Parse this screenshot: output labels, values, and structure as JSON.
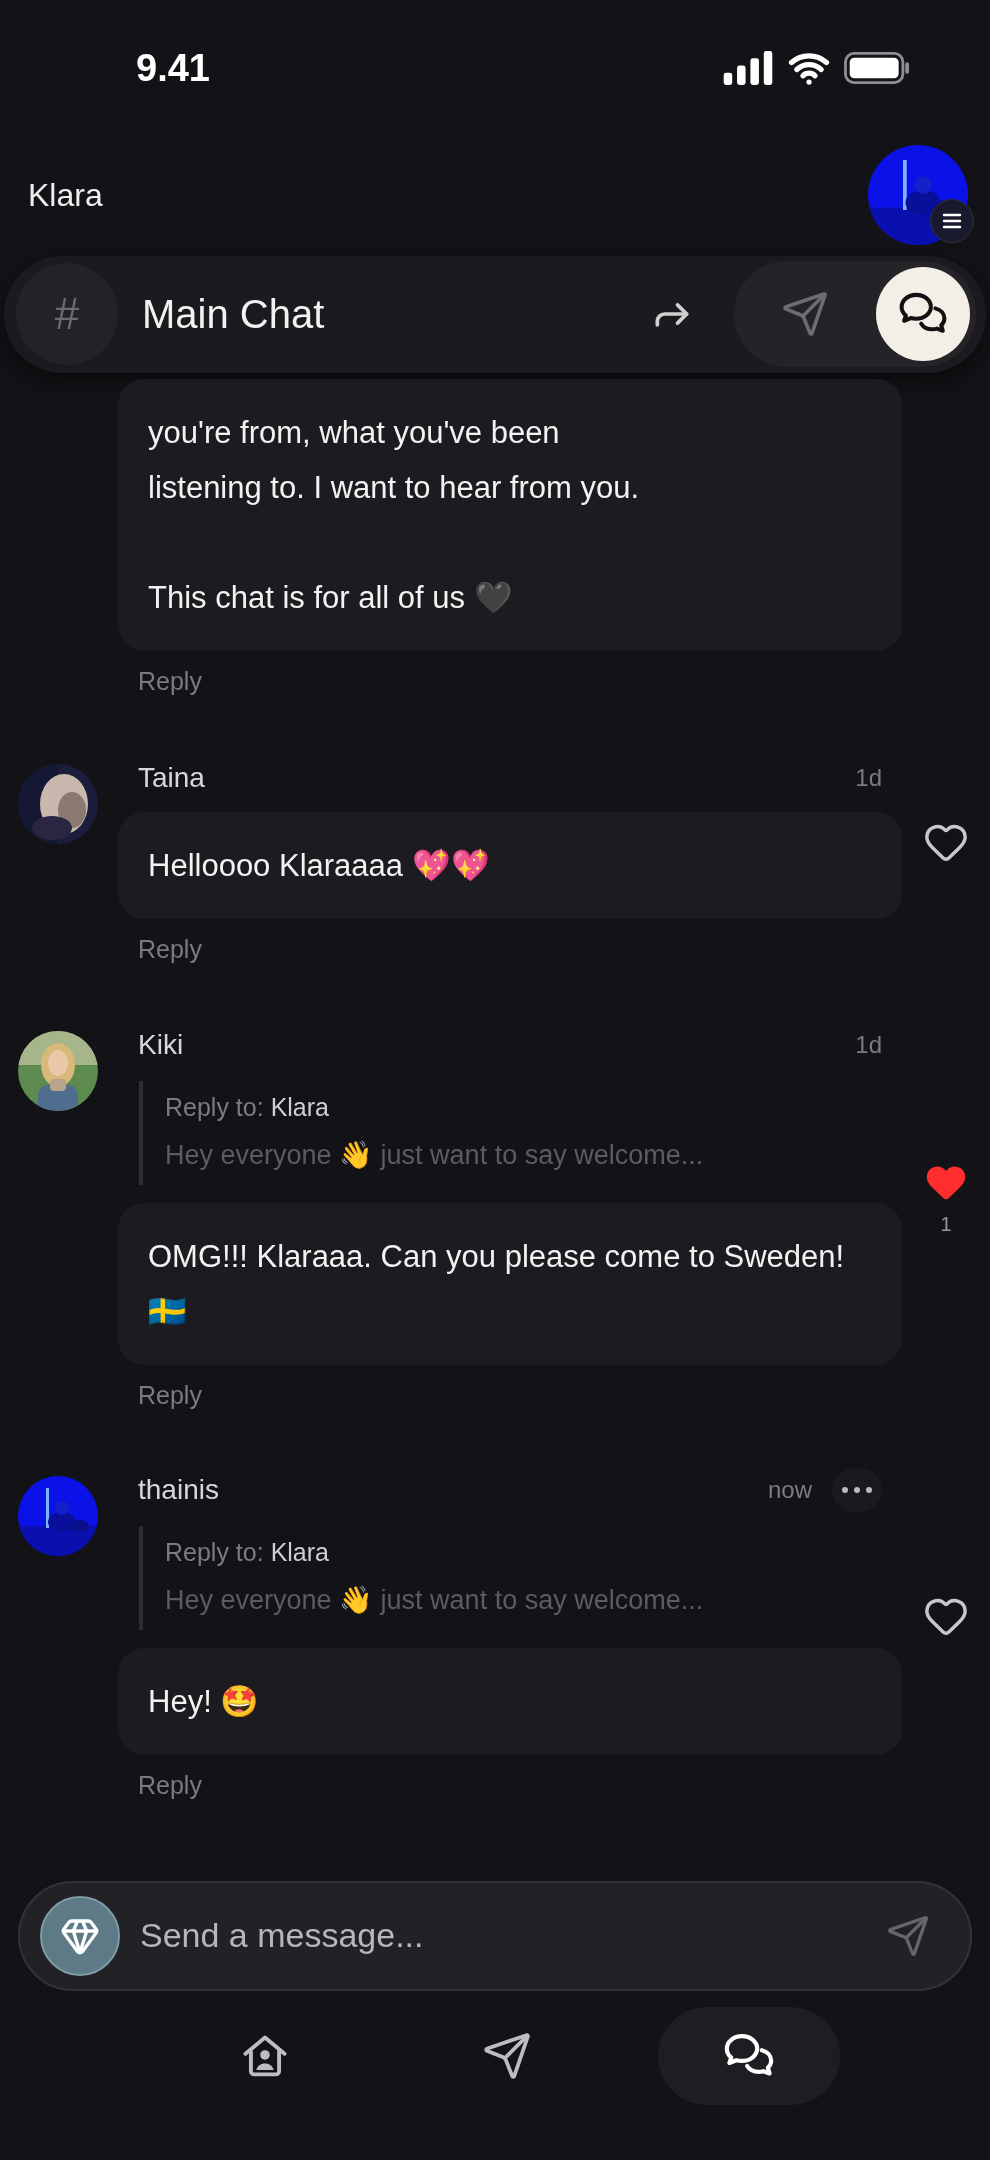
{
  "status_bar": {
    "time": "9.41"
  },
  "header": {
    "title": "Klara"
  },
  "channel_bar": {
    "icon_text": "#",
    "title": "Main Chat",
    "views": [
      {
        "kind": "send",
        "selected": false
      },
      {
        "kind": "chats",
        "selected": true
      }
    ]
  },
  "messages": [
    {
      "kind": "continued",
      "text": "you're from, what you've been\nlistening to. I want to hear from you.\n\nThis chat is for all of us 🖤",
      "reply_label": "Reply"
    },
    {
      "kind": "message",
      "author": "Taina",
      "time": "1d",
      "text": "Helloooo Klaraaaa 💖💖",
      "liked": false,
      "reply_label": "Reply"
    },
    {
      "kind": "message",
      "author": "Kiki",
      "time": "1d",
      "quote": {
        "label": "Reply to:",
        "name": "Klara",
        "text": "Hey everyone 👋 just want to say welcome..."
      },
      "text": "OMG!!! Klaraaa. Can you please come to Sweden! 🇸🇪",
      "liked": true,
      "like_count": "1",
      "reply_label": "Reply"
    },
    {
      "kind": "message",
      "author": "thainis",
      "time": "now",
      "menu": true,
      "quote": {
        "label": "Reply to:",
        "name": "Klara",
        "text": "Hey everyone 👋 just want to say welcome..."
      },
      "text": "Hey! 🤩",
      "liked": false,
      "reply_label": "Reply"
    }
  ],
  "composer": {
    "placeholder": "Send a message..."
  },
  "nav": [
    {
      "kind": "home",
      "selected": false
    },
    {
      "kind": "send",
      "selected": false
    },
    {
      "kind": "chats",
      "selected": true
    }
  ]
}
